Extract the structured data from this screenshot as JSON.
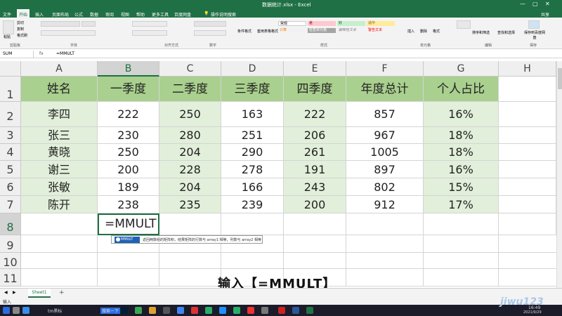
{
  "window": {
    "title": "数据统计.xlsx - Excel",
    "share_label": "共享"
  },
  "ribbon": {
    "tabs": [
      "文件",
      "开始",
      "插入",
      "页面布局",
      "公式",
      "数据",
      "审阅",
      "视图",
      "帮助",
      "更多工具",
      "百度网盘"
    ],
    "active_tab": "开始",
    "tell_me": "操作说明搜索",
    "groups": [
      "剪贴板",
      "字体",
      "对齐方式",
      "数字",
      "样式",
      "单元格",
      "编辑",
      "保存"
    ],
    "paste_label": "粘贴",
    "clipboard_items": [
      "剪切",
      "复制",
      "格式刷"
    ],
    "styles": {
      "normal": "常规",
      "bad": "差",
      "good": "好",
      "neutral": "适中",
      "calc": "计算",
      "check": "检查单元格",
      "explain": "解释性文本",
      "warning": "警告文本"
    },
    "conditional_format": "条件格式",
    "table_format": "套用表格格式",
    "insert": "插入",
    "delete": "删除",
    "format": "格式",
    "sort_filter": "排序和筛选",
    "find_select": "查找和选择",
    "save_baidu": "保存到百度网盘"
  },
  "formula_bar": {
    "name_box": "SUM",
    "fx": "fx",
    "value": "=MMULT"
  },
  "columns": [
    "A",
    "B",
    "C",
    "D",
    "E",
    "F",
    "G",
    "H"
  ],
  "rows": [
    "1",
    "2",
    "3",
    "4",
    "5",
    "6",
    "7",
    "8",
    "9",
    "10",
    "11"
  ],
  "table": {
    "headers": [
      "姓名",
      "一季度",
      "二季度",
      "三季度",
      "四季度",
      "年度总计",
      "个人占比"
    ],
    "data": [
      [
        "李四",
        "222",
        "250",
        "163",
        "222",
        "857",
        "16%"
      ],
      [
        "张三",
        "230",
        "280",
        "251",
        "206",
        "967",
        "18%"
      ],
      [
        "黄晓",
        "250",
        "204",
        "290",
        "261",
        "1005",
        "18%"
      ],
      [
        "谢三",
        "200",
        "228",
        "278",
        "191",
        "897",
        "16%"
      ],
      [
        "张敏",
        "189",
        "204",
        "166",
        "243",
        "802",
        "15%"
      ],
      [
        "陈开",
        "238",
        "235",
        "239",
        "200",
        "912",
        "17%"
      ]
    ],
    "editing_cell": "=MMULT"
  },
  "autocomplete": {
    "function": "MMULT",
    "description": "返回两数组的矩阵积，结果矩阵的行数与 array1 相等，列数与 array2 相等"
  },
  "caption": "输入【=MMULT】",
  "sheet": {
    "tab": "Sheet1",
    "add": "+"
  },
  "status": {
    "mode": "输入"
  },
  "taskbar": {
    "items": [
      "tm黑标",
      "搜索一下"
    ],
    "time": "16:49",
    "date": "2021/9/29"
  },
  "watermark": "jiwu123"
}
